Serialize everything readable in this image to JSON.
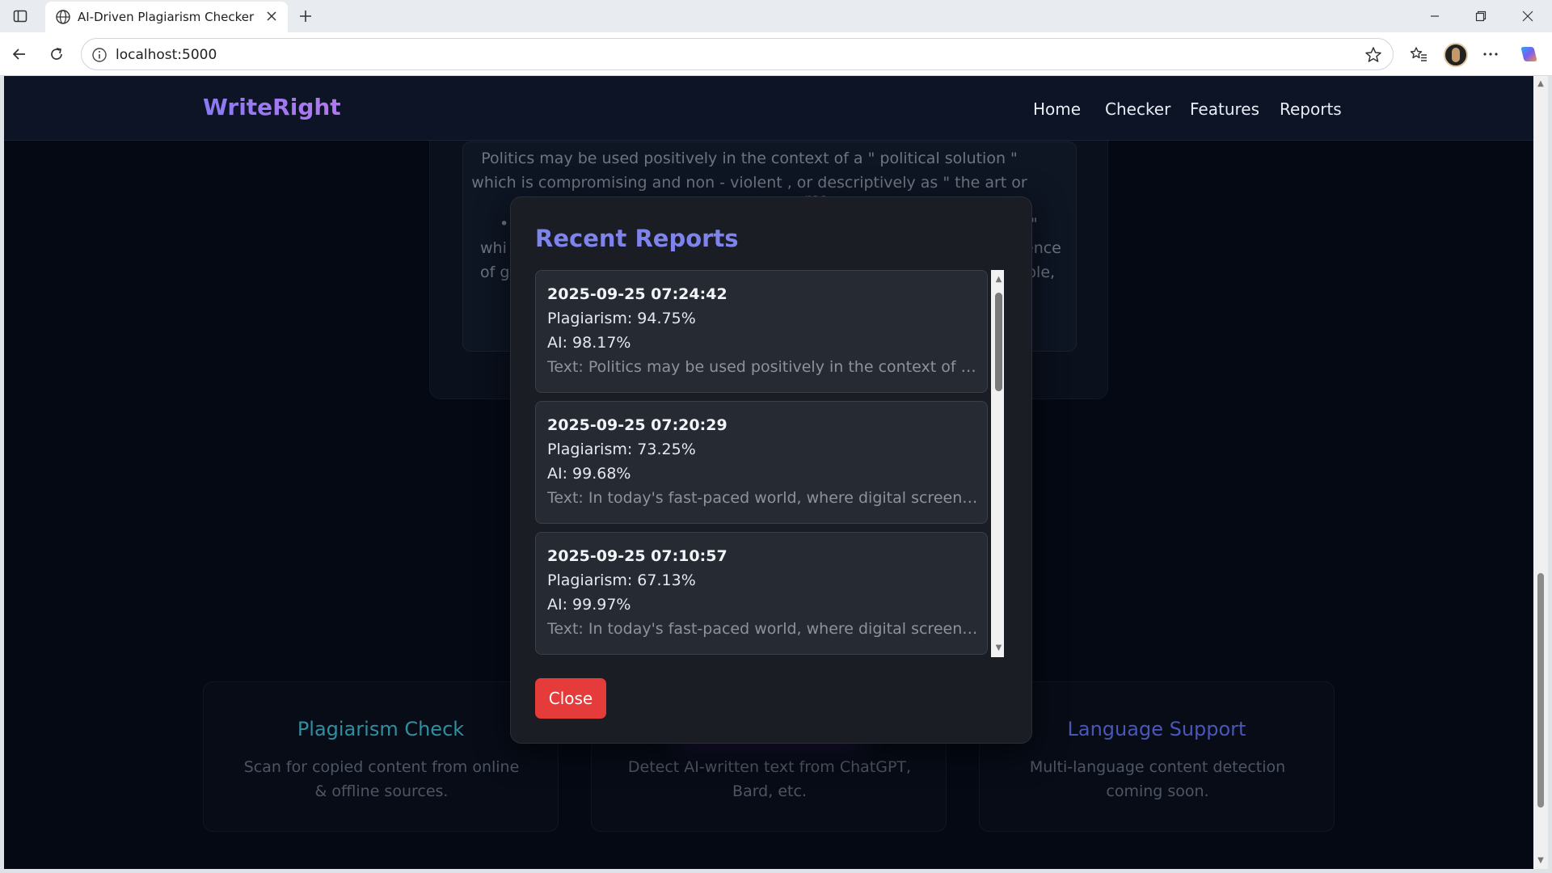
{
  "browser": {
    "tab_title": "AI-Driven Plagiarism Checker",
    "url": "localhost:5000",
    "icons": [
      "sidebar-icon",
      "globe-icon",
      "close-icon",
      "plus-icon",
      "back-icon",
      "reload-icon",
      "info-icon",
      "star-icon",
      "favorites-icon",
      "more-icon",
      "copilot-icon"
    ]
  },
  "site": {
    "logo": "WriteRight",
    "nav": [
      "Home",
      "Checker",
      "Features",
      "Reports"
    ],
    "background_text": "Politics may be used positively in the context of a \" political solution \" which is compromising and non - violent , or descriptively as \" the art or science of gov",
    "background_text_fragments": [
      "gov",
      "rce",
      "•",
      "\"",
      "whi",
      "ence",
      "of g",
      "ple,"
    ],
    "features": [
      {
        "title": "Plagiarism Check",
        "desc": "Scan for copied content from online & offline sources.",
        "color": "#2f8fa0"
      },
      {
        "title": "",
        "desc": "Detect AI-written text from ChatGPT, Bard, etc.",
        "color": "#6a4fd0"
      },
      {
        "title": "Language Support",
        "desc": "Multi-language content detection coming soon.",
        "color": "#4a56b8"
      }
    ]
  },
  "modal": {
    "title": "Recent Reports",
    "reports": [
      {
        "date": "2025-09-25 07:24:42",
        "plagiarism": "Plagiarism: 94.75%",
        "ai": "AI: 98.17%",
        "text": "Text: Politics may be used positively in the context of a \"p..."
      },
      {
        "date": "2025-09-25 07:20:29",
        "plagiarism": "Plagiarism: 73.25%",
        "ai": "AI: 99.68%",
        "text": "Text: In today's fast-paced world, where digital screens do..."
      },
      {
        "date": "2025-09-25 07:10:57",
        "plagiarism": "Plagiarism: 67.13%",
        "ai": "AI: 99.97%",
        "text": "Text: In today's fast-paced world, where digital screens do..."
      }
    ],
    "close_label": "Close",
    "accent_color": "#7f83ec",
    "close_color": "#e53b3b"
  }
}
